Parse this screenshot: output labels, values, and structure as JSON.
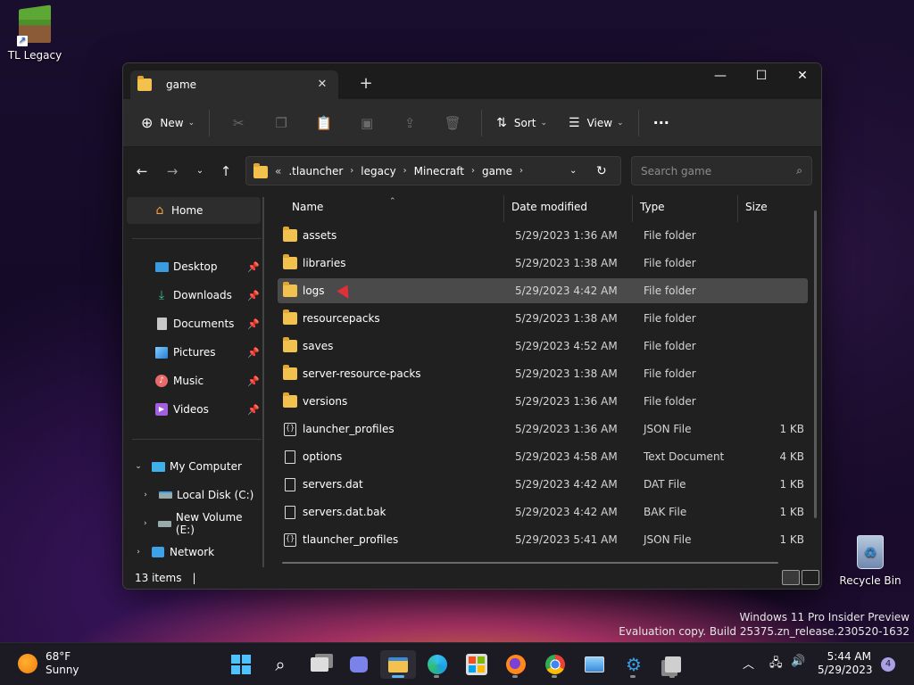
{
  "desktop": {
    "icons": [
      {
        "label": "TL Legacy"
      },
      {
        "label": "Recycle Bin"
      }
    ]
  },
  "window": {
    "tab_title": "game",
    "new_tab_symbol": "+",
    "controls": {
      "minimize": "—",
      "maximize": "☐",
      "close": "✕"
    }
  },
  "toolbar": {
    "new_label": "New",
    "sort_label": "Sort",
    "view_label": "View",
    "more_label": "···"
  },
  "address": {
    "overflow": "«",
    "crumbs": [
      ".tlauncher",
      "legacy",
      "Minecraft",
      "game"
    ],
    "search_placeholder": "Search game"
  },
  "nav": {
    "home": "Home",
    "quick_access": [
      {
        "label": "Desktop",
        "icon": "desktop-icon",
        "color": "#3a9be0"
      },
      {
        "label": "Downloads",
        "icon": "downloads-icon",
        "color": "#3fbf8a"
      },
      {
        "label": "Documents",
        "icon": "documents-icon",
        "color": "#c8c8c8"
      },
      {
        "label": "Pictures",
        "icon": "pictures-icon",
        "color": "#3fa2e8"
      },
      {
        "label": "Music",
        "icon": "music-icon",
        "color": "#e86a6a"
      },
      {
        "label": "Videos",
        "icon": "videos-icon",
        "color": "#a35fe0"
      }
    ],
    "my_computer": "My Computer",
    "drives": [
      "Local Disk (C:)",
      "New Volume (E:)"
    ],
    "network": "Network"
  },
  "columns": {
    "name": "Name",
    "date": "Date modified",
    "type": "Type",
    "size": "Size"
  },
  "files": [
    {
      "name": "assets",
      "date": "5/29/2023 1:36 AM",
      "type": "File folder",
      "size": "",
      "kind": "folder"
    },
    {
      "name": "libraries",
      "date": "5/29/2023 1:38 AM",
      "type": "File folder",
      "size": "",
      "kind": "folder"
    },
    {
      "name": "logs",
      "date": "5/29/2023 4:42 AM",
      "type": "File folder",
      "size": "",
      "kind": "folder",
      "selected": true
    },
    {
      "name": "resourcepacks",
      "date": "5/29/2023 1:38 AM",
      "type": "File folder",
      "size": "",
      "kind": "folder"
    },
    {
      "name": "saves",
      "date": "5/29/2023 4:52 AM",
      "type": "File folder",
      "size": "",
      "kind": "folder"
    },
    {
      "name": "server-resource-packs",
      "date": "5/29/2023 1:38 AM",
      "type": "File folder",
      "size": "",
      "kind": "folder"
    },
    {
      "name": "versions",
      "date": "5/29/2023 1:36 AM",
      "type": "File folder",
      "size": "",
      "kind": "folder"
    },
    {
      "name": "launcher_profiles",
      "date": "5/29/2023 1:36 AM",
      "type": "JSON File",
      "size": "1 KB",
      "kind": "json"
    },
    {
      "name": "options",
      "date": "5/29/2023 4:58 AM",
      "type": "Text Document",
      "size": "4 KB",
      "kind": "doc"
    },
    {
      "name": "servers.dat",
      "date": "5/29/2023 4:42 AM",
      "type": "DAT File",
      "size": "1 KB",
      "kind": "doc"
    },
    {
      "name": "servers.dat.bak",
      "date": "5/29/2023 4:42 AM",
      "type": "BAK File",
      "size": "1 KB",
      "kind": "doc"
    },
    {
      "name": "tlauncher_profiles",
      "date": "5/29/2023 5:41 AM",
      "type": "JSON File",
      "size": "1 KB",
      "kind": "json"
    }
  ],
  "status": {
    "count": "13 items",
    "separator": "|"
  },
  "watermark": {
    "line1": "Windows 11 Pro Insider Preview",
    "line2": "Evaluation copy. Build 25375.zn_release.230520-1632"
  },
  "taskbar": {
    "weather_temp": "68°F",
    "weather_desc": "Sunny",
    "time": "5:44 AM",
    "date": "5/29/2023",
    "notifications": "4"
  }
}
